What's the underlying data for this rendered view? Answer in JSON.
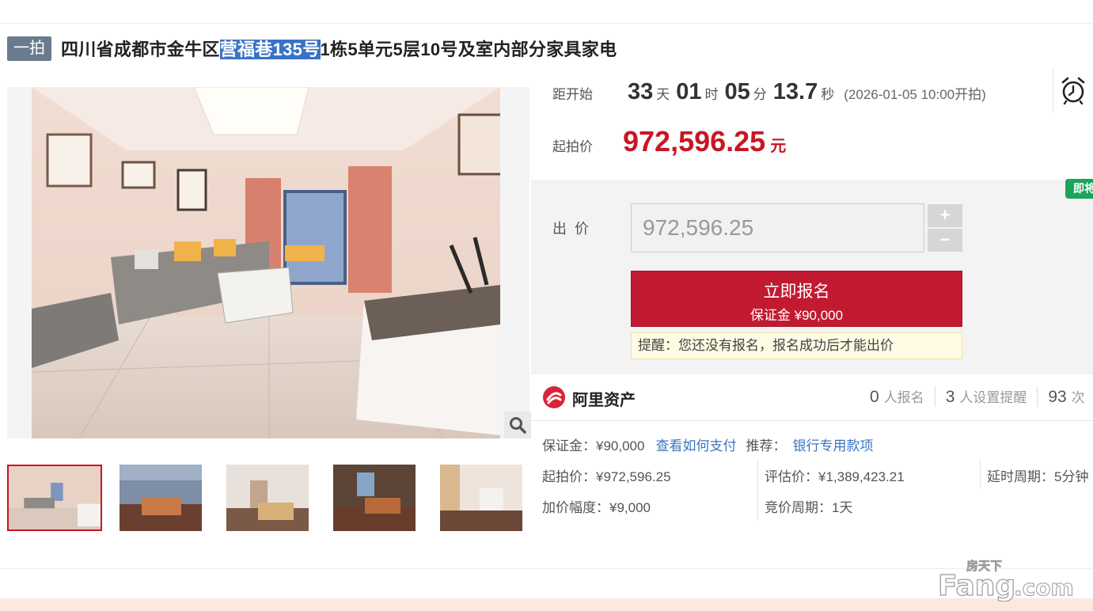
{
  "title": {
    "round_badge": "一拍",
    "text_before": "四川省成都市金牛区",
    "text_highlight": "营福巷135号",
    "text_after": "1栋5单元5层10号及室内部分家具家电"
  },
  "countdown": {
    "label": "距开始",
    "days": "33",
    "days_unit": "天",
    "hours": "01",
    "hours_unit": "时",
    "minutes": "05",
    "minutes_unit": "分",
    "seconds": "13.7",
    "seconds_unit": "秒",
    "start_time": "(2026-01-05 10:00开拍)"
  },
  "starting_price": {
    "label": "起拍价",
    "value": "972,596.25",
    "unit": "元"
  },
  "instant_tag": "即将",
  "bid": {
    "label": "出价",
    "input_value": "972,596.25",
    "plus": "+",
    "minus": "−"
  },
  "signup_button": {
    "line1": "立即报名",
    "line2": "保证金 ¥90,000"
  },
  "notice": "提醒：您还没有报名，报名成功后才能出价",
  "platform": {
    "name": "阿里资产",
    "registered_count": "0",
    "registered_label": "人报名",
    "reminder_count": "3",
    "reminder_label": "人设置提醒",
    "views_count": "93",
    "views_label": "次"
  },
  "details": {
    "deposit": "保证金：¥90,000",
    "how_to_pay": "查看如何支付",
    "recommend_label": "推荐：",
    "recommend_link": "银行专用款项",
    "start_price": "起拍价：¥972,596.25",
    "appraisal": "评估价：¥1,389,423.21",
    "delay_period": "延时周期：5分钟",
    "increment": "加价幅度：¥9,000",
    "bid_period": "竞价周期：1天"
  },
  "gallery": {
    "main_alt": "客厅照片",
    "thumbnails": [
      "living-room",
      "bedroom-1",
      "bedroom-2",
      "bedroom-3",
      "hallway"
    ],
    "active_index": 0
  },
  "watermark": {
    "line1": "房天下",
    "line2": "Fang.com"
  },
  "colors": {
    "accent_red": "#c21a30",
    "price_red": "#c81623",
    "link_blue": "#3a76c0",
    "tag_green": "#1aa55a"
  }
}
